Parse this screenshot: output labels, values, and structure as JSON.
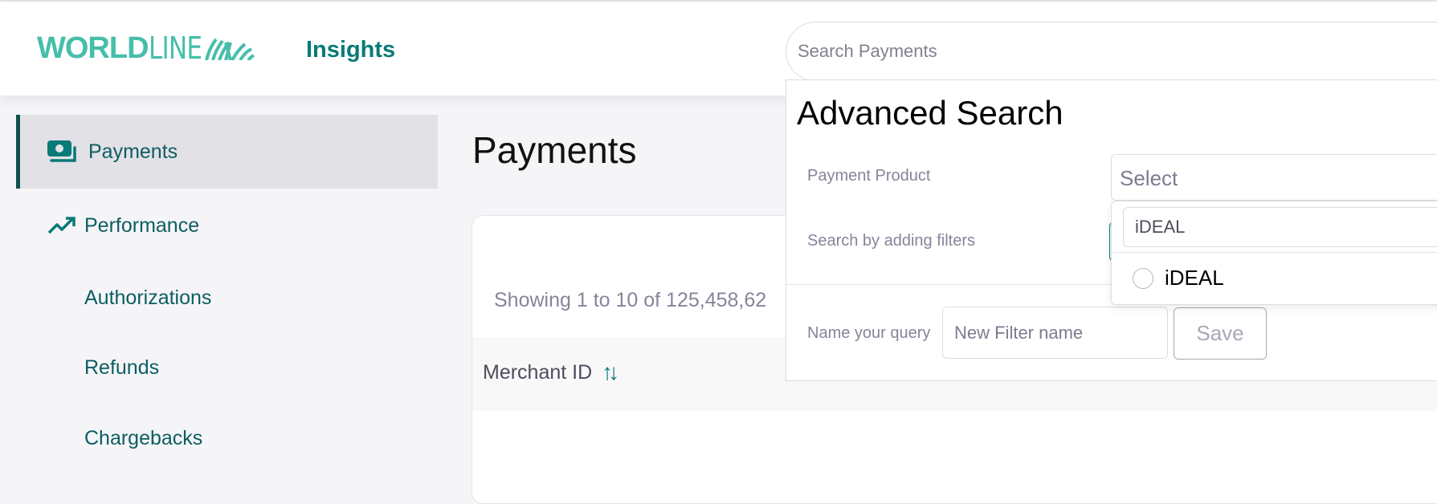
{
  "header": {
    "brand_bold": "WORLD",
    "brand_light": "LINE",
    "app_name": "Insights",
    "search_placeholder": "Search Payments"
  },
  "sidebar": {
    "items": [
      {
        "label": "Payments",
        "icon": "payments-icon",
        "active": true
      },
      {
        "label": "Performance",
        "icon": "trending-up-icon",
        "active": false
      },
      {
        "label": "Authorizations",
        "active": false
      },
      {
        "label": "Refunds",
        "active": false
      },
      {
        "label": "Chargebacks",
        "active": false
      }
    ]
  },
  "main": {
    "title": "Payments",
    "showing_text": "Showing 1 to 10 of 125,458,62",
    "columns": [
      {
        "label": "Merchant ID",
        "sort_icon": "⇅"
      }
    ]
  },
  "advanced_search": {
    "title": "Advanced Search",
    "payment_product_label": "Payment Product",
    "select_placeholder": "Select",
    "filters_label": "Search by adding filters",
    "dropdown_search_value": "iDEAL",
    "options": [
      {
        "label": "iDEAL",
        "selected": false
      }
    ],
    "name_query_label": "Name your query",
    "name_placeholder": "New Filter name",
    "save_label": "Save"
  },
  "colors": {
    "brand": "#46beaa",
    "accent": "#087a78",
    "nav_text": "#0d5d61",
    "active_border": "#124e4c"
  }
}
